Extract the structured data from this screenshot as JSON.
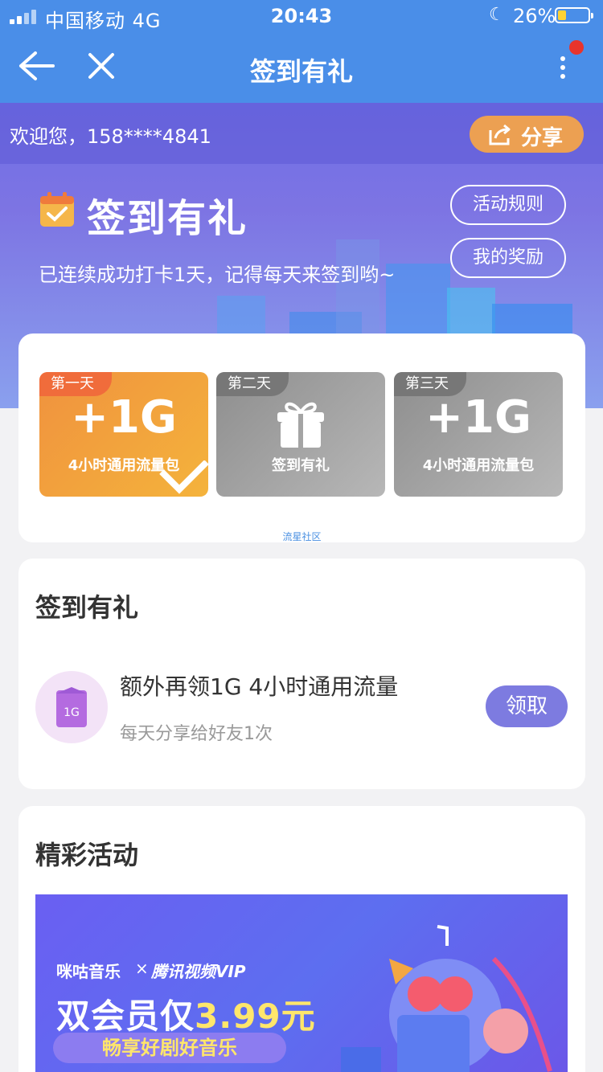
{
  "status_bar": {
    "carrier": "中国移动  4G",
    "time": "20:43",
    "battery": "26%"
  },
  "nav": {
    "title": "签到有礼"
  },
  "hero": {
    "welcome": "欢迎您，158****4841",
    "share_label": "分享",
    "title": "签到有礼",
    "subtitle": "已连续成功打卡1天，记得每天来签到哟~",
    "rules_label": "活动规则",
    "rewards_label": "我的奖励"
  },
  "checkin": {
    "days": [
      {
        "tag": "第一天",
        "big": "+1G",
        "small": "4小时通用流量包",
        "checked": true
      },
      {
        "tag": "第二天",
        "small": "签到有礼",
        "icon": "gift-icon"
      },
      {
        "tag": "第三天",
        "big": "+1G",
        "small": "4小时通用流量包"
      }
    ],
    "footer": "流星社区"
  },
  "task": {
    "section_title": "签到有礼",
    "icon_text": "1G",
    "title": "额外再领1G 4小时通用流量",
    "subtitle": "每天分享给好友1次",
    "button": "领取"
  },
  "activities": {
    "section_title": "精彩活动",
    "banner": {
      "brand1": "咪咕音乐",
      "brand2": "腾讯视频VIP",
      "headline_prefix": "双会员仅",
      "headline_price": "3.99元",
      "tagline": "畅享好剧好音乐"
    }
  },
  "colors": {
    "nav_blue": "#4a8ee8",
    "accent_orange": "#eca052",
    "button_purple": "#7d7be0"
  }
}
